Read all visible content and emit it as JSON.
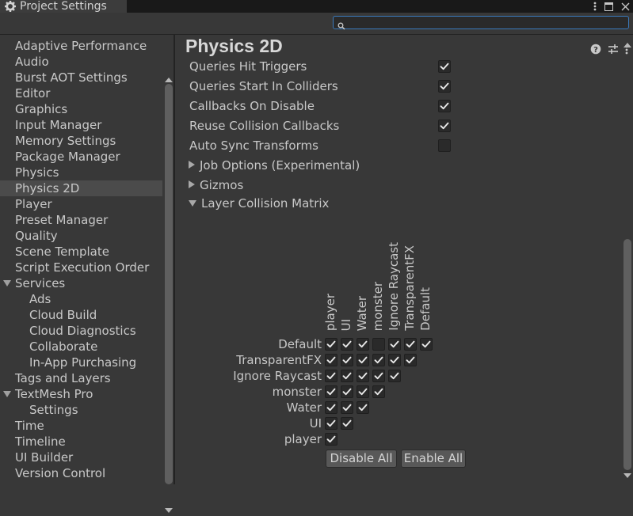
{
  "window": {
    "title": "Project Settings",
    "search_placeholder": ""
  },
  "sidebar": {
    "items": [
      {
        "label": "Adaptive Performance"
      },
      {
        "label": "Audio"
      },
      {
        "label": "Burst AOT Settings"
      },
      {
        "label": "Editor"
      },
      {
        "label": "Graphics"
      },
      {
        "label": "Input Manager"
      },
      {
        "label": "Memory Settings"
      },
      {
        "label": "Package Manager"
      },
      {
        "label": "Physics"
      },
      {
        "label": "Physics 2D"
      },
      {
        "label": "Player"
      },
      {
        "label": "Preset Manager"
      },
      {
        "label": "Quality"
      },
      {
        "label": "Scene Template"
      },
      {
        "label": "Script Execution Order"
      },
      {
        "label": "Services"
      },
      {
        "label": "Ads"
      },
      {
        "label": "Cloud Build"
      },
      {
        "label": "Cloud Diagnostics"
      },
      {
        "label": "Collaborate"
      },
      {
        "label": "In-App Purchasing"
      },
      {
        "label": "Tags and Layers"
      },
      {
        "label": "TextMesh Pro"
      },
      {
        "label": "Settings"
      },
      {
        "label": "Time"
      },
      {
        "label": "Timeline"
      },
      {
        "label": "UI Builder"
      },
      {
        "label": "Version Control"
      }
    ],
    "selected": "Physics 2D"
  },
  "main": {
    "title": "Physics 2D",
    "properties": [
      {
        "label": "Queries Hit Triggers",
        "checked": true
      },
      {
        "label": "Queries Start In Colliders",
        "checked": true
      },
      {
        "label": "Callbacks On Disable",
        "checked": true
      },
      {
        "label": "Reuse Collision Callbacks",
        "checked": true
      },
      {
        "label": "Auto Sync Transforms",
        "checked": false
      }
    ],
    "foldouts": [
      {
        "label": "Job Options (Experimental)",
        "expanded": false
      },
      {
        "label": "Gizmos",
        "expanded": false
      },
      {
        "label": "Layer Collision Matrix",
        "expanded": true
      }
    ],
    "matrix": {
      "column_labels": [
        "player",
        "UI",
        "Water",
        "monster",
        "Ignore Raycast",
        "TransparentFX",
        "Default"
      ],
      "row_labels": [
        "Default",
        "TransparentFX",
        "Ignore Raycast",
        "monster",
        "Water",
        "UI",
        "player"
      ],
      "rows": [
        [
          true,
          true,
          true,
          false,
          true,
          true,
          true
        ],
        [
          true,
          true,
          true,
          true,
          true,
          true
        ],
        [
          true,
          true,
          true,
          true,
          true
        ],
        [
          true,
          true,
          true,
          true
        ],
        [
          true,
          true,
          true
        ],
        [
          true,
          true
        ],
        [
          true
        ]
      ]
    },
    "disable_all_label": "Disable All",
    "enable_all_label": "Enable All"
  },
  "colors": {
    "background": "#383838",
    "selected_row": "#4b4b4b",
    "search_border": "#3a79bb",
    "checkmark": "#e8e8e8"
  }
}
